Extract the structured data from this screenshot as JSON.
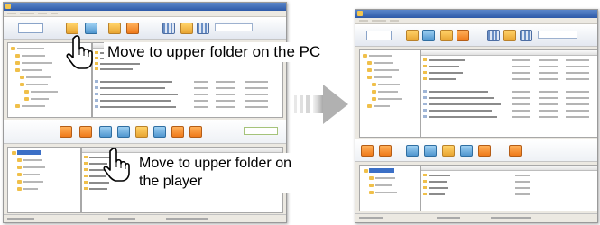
{
  "callouts": {
    "pc_upper": "Move to upper folder on the PC",
    "player_upper_line1": "Move to upper folder on",
    "player_upper_line2": "the player"
  },
  "icons": {
    "pointer": "hand-pointer-icon",
    "transition": "right-arrow-icon"
  },
  "colors": {
    "title_bar": "#2e5aa8",
    "folder": "#f0c04a",
    "selection": "#3b6fc6",
    "arrow": "#b8b8b8"
  }
}
